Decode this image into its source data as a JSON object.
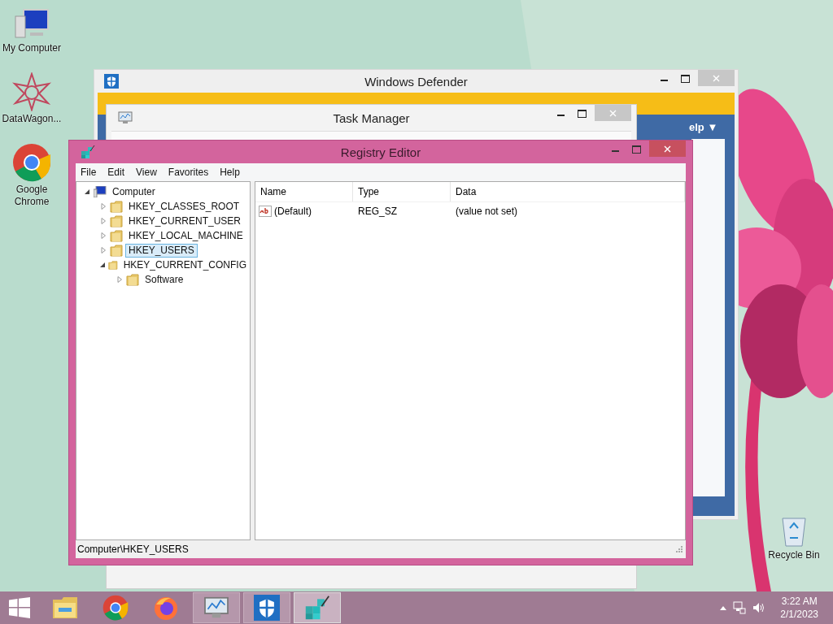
{
  "desktop_icons": [
    {
      "label": "My Computer",
      "kind": "computer"
    },
    {
      "label": "DataWagon...",
      "kind": "datawagon"
    },
    {
      "label": "Google Chrome",
      "kind": "chrome"
    },
    {
      "label": "Recycle Bin",
      "kind": "recycle"
    }
  ],
  "defender": {
    "title": "Windows Defender",
    "help_menu": "elp ▼"
  },
  "task_manager": {
    "title": "Task Manager"
  },
  "registry_editor": {
    "title": "Registry Editor",
    "menu": [
      "File",
      "Edit",
      "View",
      "Favorites",
      "Help"
    ],
    "tree": {
      "label": "Computer",
      "expanded": true,
      "selected": false,
      "children": [
        {
          "label": "HKEY_CLASSES_ROOT",
          "expanded": false,
          "selected": false
        },
        {
          "label": "HKEY_CURRENT_USER",
          "expanded": false,
          "selected": false
        },
        {
          "label": "HKEY_LOCAL_MACHINE",
          "expanded": false,
          "selected": false
        },
        {
          "label": "HKEY_USERS",
          "expanded": false,
          "selected": true
        },
        {
          "label": "HKEY_CURRENT_CONFIG",
          "expanded": true,
          "selected": false,
          "children": [
            {
              "label": "Software",
              "expanded": false,
              "selected": false
            }
          ]
        }
      ]
    },
    "columns": [
      "Name",
      "Type",
      "Data"
    ],
    "rows": [
      {
        "name": "(Default)",
        "type": "REG_SZ",
        "data": "(value not set)"
      }
    ],
    "status_bar": "Computer\\HKEY_USERS"
  },
  "taskbar": {
    "apps": [
      {
        "kind": "explorer",
        "running": false,
        "selected": false
      },
      {
        "kind": "chrome",
        "running": false,
        "selected": false
      },
      {
        "kind": "firefox",
        "running": false,
        "selected": false
      },
      {
        "kind": "taskmgr",
        "running": true,
        "selected": false
      },
      {
        "kind": "defender",
        "running": true,
        "selected": false
      },
      {
        "kind": "regedit",
        "running": true,
        "selected": true
      }
    ],
    "time": "3:22 AM",
    "date": "2/1/2023"
  }
}
